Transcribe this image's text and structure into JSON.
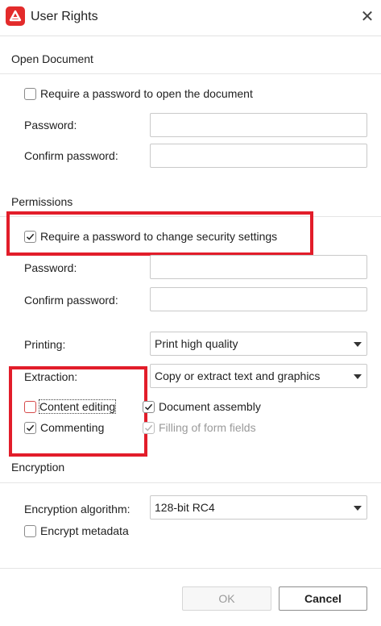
{
  "window": {
    "title": "User Rights",
    "accent": "#e32b2b"
  },
  "open_document": {
    "section_title": "Open Document",
    "require_label": "Require a password to open the document",
    "require_checked": false,
    "password_label": "Password:",
    "password_value": "",
    "confirm_label": "Confirm password:",
    "confirm_value": ""
  },
  "permissions": {
    "section_title": "Permissions",
    "require_label": "Require a password to change security settings",
    "require_checked": true,
    "password_label": "Password:",
    "password_value": "",
    "confirm_label": "Confirm password:",
    "confirm_value": "",
    "printing_label": "Printing:",
    "printing_value": "Print high quality",
    "extraction_label": "Extraction:",
    "extraction_value": "Copy or extract text and graphics",
    "options": [
      {
        "label": "Content editing",
        "checked": false,
        "enabled": true
      },
      {
        "label": "Document assembly",
        "checked": true,
        "enabled": true
      },
      {
        "label": "Commenting",
        "checked": true,
        "enabled": true
      },
      {
        "label": "Filling of form fields",
        "checked": true,
        "enabled": false
      }
    ]
  },
  "encryption": {
    "section_title": "Encryption",
    "algorithm_label": "Encryption algorithm:",
    "algorithm_value": "128-bit RC4",
    "metadata_label": "Encrypt metadata",
    "metadata_checked": false
  },
  "footer": {
    "ok_label": "OK",
    "cancel_label": "Cancel"
  },
  "highlight_color": "#e21d2a"
}
